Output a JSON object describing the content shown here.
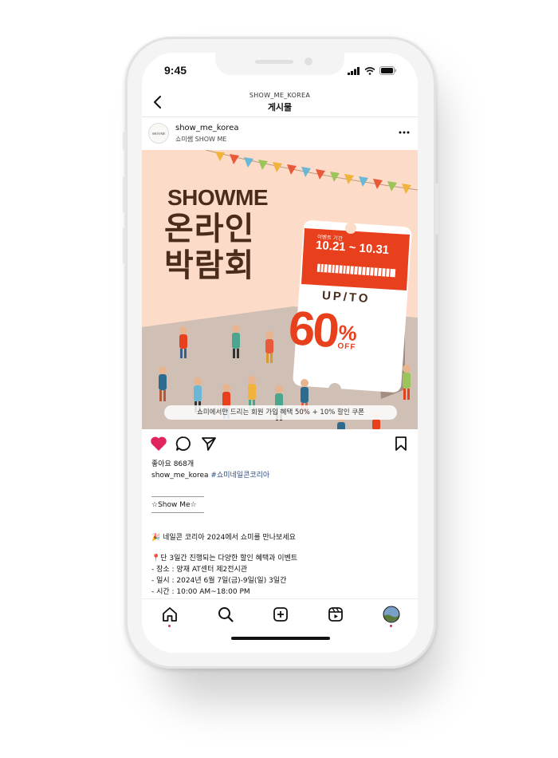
{
  "status": {
    "time": "9:45"
  },
  "header": {
    "account": "SHOW_ME_KOREA",
    "title": "게시물"
  },
  "post": {
    "avatar_text": "SHOWME",
    "username": "show_me_korea",
    "subname": "쇼미쌤 SHOW ME"
  },
  "banner": {
    "brand": "SHOWME",
    "title_line1": "온라인",
    "title_line2": "박람회",
    "period_label": "이벤트 기간",
    "period": "10.21 ~ 10.31",
    "upto": "UP/TO",
    "discount": "60",
    "percent": "%",
    "off": "OFF",
    "pill_text": "쇼미에서만 드리는 회원 가입 혜택 50% + 10% 할인 쿠폰",
    "colors": {
      "background": "#fcdcc9",
      "ticket_red": "#e8401c",
      "brown": "#4a2c1d"
    }
  },
  "engagement": {
    "likes": "좋아요 868개"
  },
  "caption": {
    "user": "show_me_korea",
    "hashtag": "#쇼미네일콘코리아",
    "box_text": "☆Show Me☆",
    "line1": "🎉 네일콘 코리아 2024에서 쇼미를 만나보세요",
    "line2": "📍단 3일간 진행되는 다양한 할인 혜택과 이벤트",
    "line3": "- 장소 : 양재 AT센터 제2전시관",
    "line4": "- 일시 : 2024년 6월 7일(금)-9일(일) 3일간",
    "line5": "- 시간 : 10:00 AM~18:00 PM"
  },
  "icons": {
    "back": "chevron-left-icon",
    "more": "more-dots-icon",
    "like": "heart-icon",
    "comment": "comment-icon",
    "share": "send-icon",
    "save": "bookmark-icon",
    "tabs": [
      "home-icon",
      "search-icon",
      "add-icon",
      "reels-icon",
      "profile-avatar"
    ]
  },
  "colors": {
    "like": "#e0245e",
    "hashtag": "#2b4c86"
  }
}
